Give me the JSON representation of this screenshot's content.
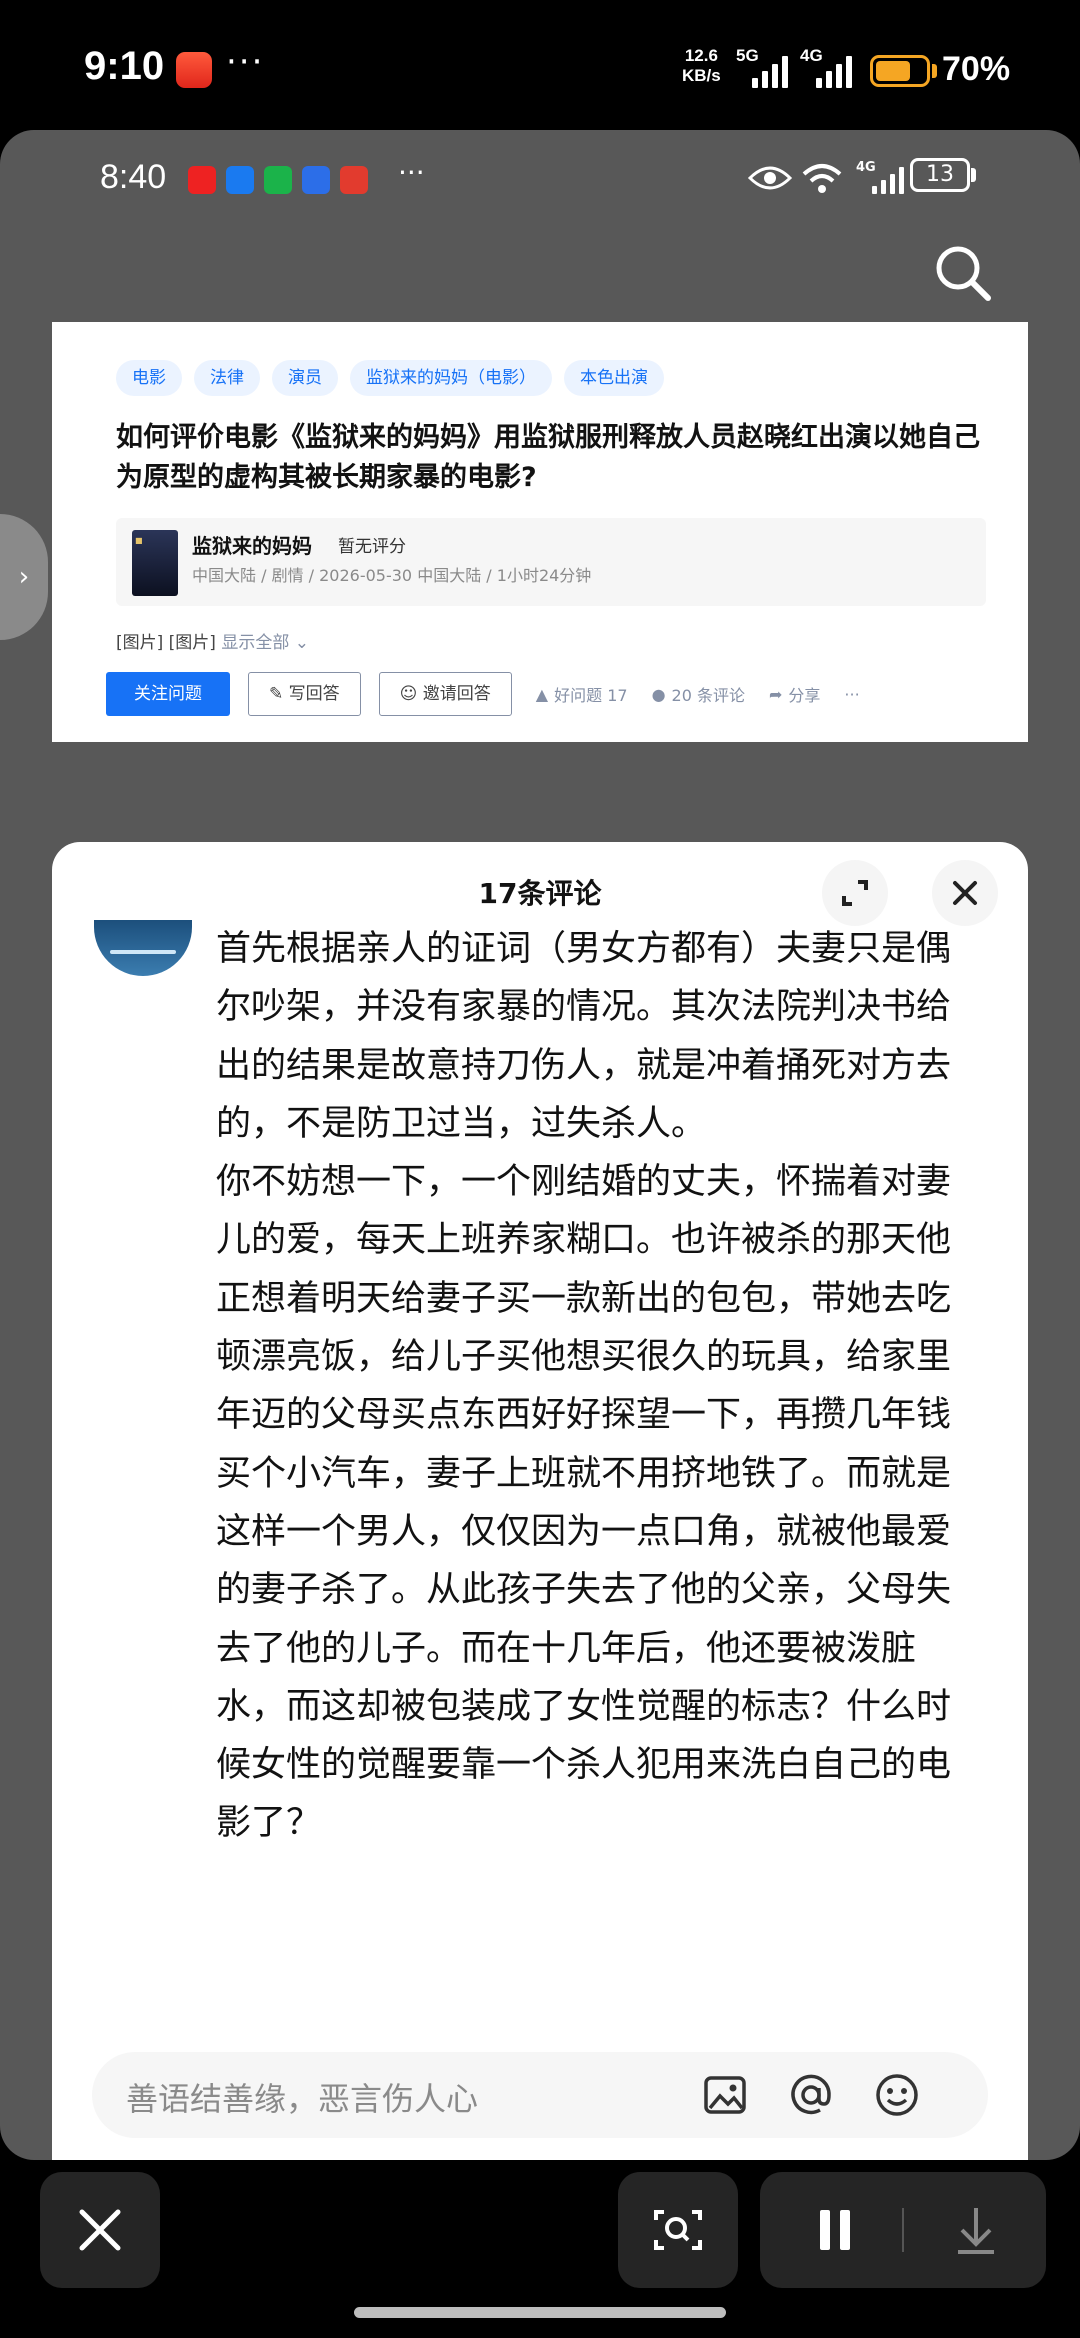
{
  "outer_status": {
    "time": "9:10",
    "dots": "···",
    "net_speed_value": "12.6",
    "net_speed_unit": "KB/s",
    "sig1": "5G",
    "sig2": "4G",
    "battery": "70%"
  },
  "inner_status": {
    "time": "8:40",
    "dots": "···",
    "net": "4G",
    "battery": "13"
  },
  "question": {
    "tags": [
      "电影",
      "法律",
      "演员",
      "监狱来的妈妈（电影）",
      "本色出演"
    ],
    "title": "如何评价电影《监狱来的妈妈》用监狱服刑释放人员赵晓红出演以她自己为原型的虚构其被长期家暴的电影?",
    "movie": {
      "name": "监狱来的妈妈",
      "score": "暂无评分",
      "meta": "中国大陆 / 剧情 / 2026-05-30 中国大陆 / 1小时24分钟"
    },
    "images_text": "[图片] [图片]",
    "show_all": "显示全部",
    "follow": "关注问题",
    "write": "写回答",
    "invite": "邀请回答",
    "good_question": "好问题 17",
    "comments": "20 条评论",
    "share": "分享",
    "more": "···"
  },
  "comments_sheet": {
    "title": "17条评论",
    "comment_text": "首先根据亲人的证词（男女方都有）夫妻只是偶尔吵架，并没有家暴的情况。其次法院判决书给出的结果是故意持刀伤人，就是冲着捅死对方去的，不是防卫过当，过失杀人。\n你不妨想一下，一个刚结婚的丈夫，怀揣着对妻儿的爱，每天上班养家糊口。也许被杀的那天他正想着明天给妻子买一款新出的包包，带她去吃顿漂亮饭，给儿子买他想买很久的玩具，给家里年迈的父母买点东西好好探望一下，再攒几年钱买个小汽车，妻子上班就不用挤地铁了。而就是这样一个男人，仅仅因为一点口角，就被他最爱的妻子杀了。从此孩子失去了他的父亲，父母失去了他的儿子。而在十几年后，他还要被泼脏水，而这却被包装成了女性觉醒的标志？什么时候女性的觉醒要靠一个杀人犯用来洗白自己的电影了？",
    "input_placeholder": "善语结善缘，恶言伤人心"
  },
  "colors": {
    "accent": "#1772f6",
    "battery_outer": "#f5a623"
  }
}
